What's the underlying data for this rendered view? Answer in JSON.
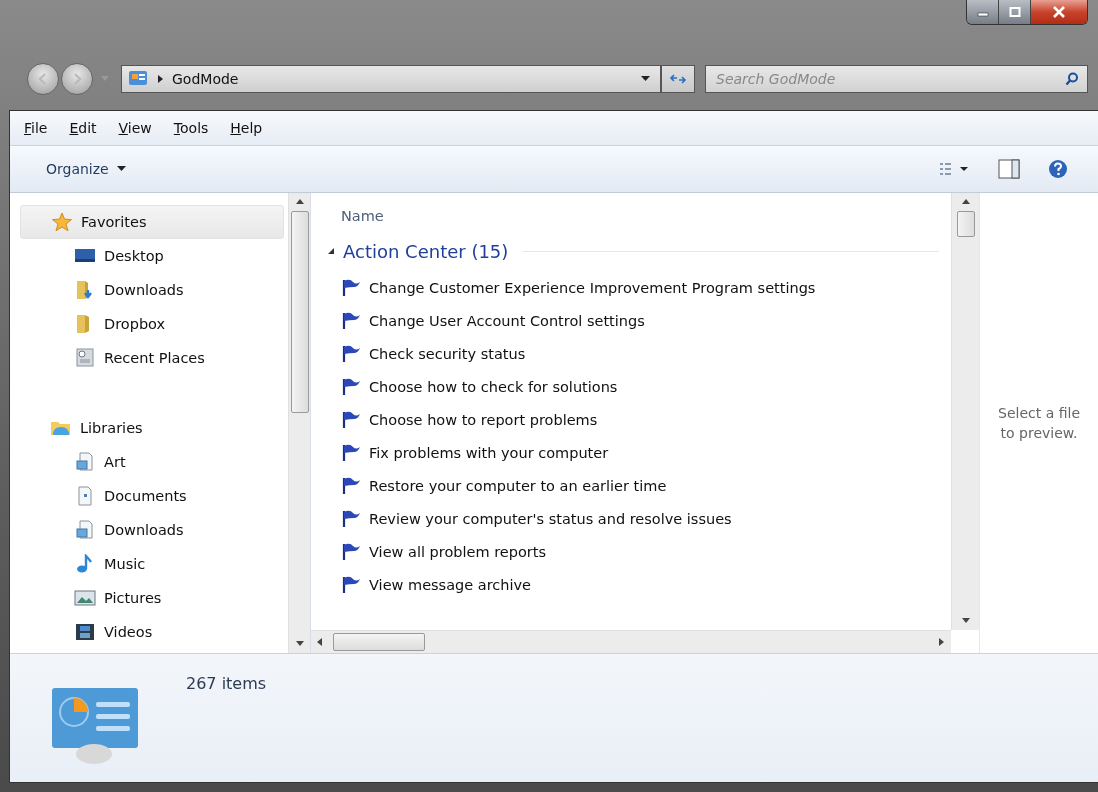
{
  "window": {
    "caption_buttons": [
      {
        "kind": "minimize"
      },
      {
        "kind": "maximize"
      },
      {
        "kind": "close"
      }
    ]
  },
  "address_bar": {
    "path": "GodMode"
  },
  "search": {
    "placeholder": "Search GodMode"
  },
  "menu": [
    {
      "label": "File"
    },
    {
      "label": "Edit"
    },
    {
      "label": "View"
    },
    {
      "label": "Tools"
    },
    {
      "label": "Help"
    }
  ],
  "toolbar": {
    "organize": "Organize"
  },
  "sidebar": {
    "groups": [
      {
        "label": "Favorites",
        "selected": true,
        "children": [
          {
            "label": "Desktop",
            "selected": false
          },
          {
            "label": "Downloads",
            "selected": false
          },
          {
            "label": "Dropbox",
            "selected": false
          },
          {
            "label": "Recent Places",
            "selected": false
          }
        ]
      },
      {
        "label": "Libraries",
        "selected": false,
        "children": [
          {
            "label": "Art",
            "selected": false
          },
          {
            "label": "Documents",
            "selected": false
          },
          {
            "label": "Downloads",
            "selected": false
          },
          {
            "label": "Music",
            "selected": false
          },
          {
            "label": "Pictures",
            "selected": false
          },
          {
            "label": "Videos",
            "selected": false
          }
        ]
      }
    ]
  },
  "file_list": {
    "column": "Name",
    "group": {
      "title": "Action Center (15)",
      "expanded": true
    },
    "items": [
      "Change Customer Experience Improvement Program settings",
      "Change User Account Control settings",
      "Check security status",
      "Choose how to check for solutions",
      "Choose how to report problems",
      "Fix problems with your computer",
      "Restore your computer to an earlier time",
      "Review your computer's status and resolve issues",
      "View all problem reports",
      "View message archive"
    ]
  },
  "preview": {
    "message": "Select a file to preview."
  },
  "details": {
    "count": "267 items"
  }
}
